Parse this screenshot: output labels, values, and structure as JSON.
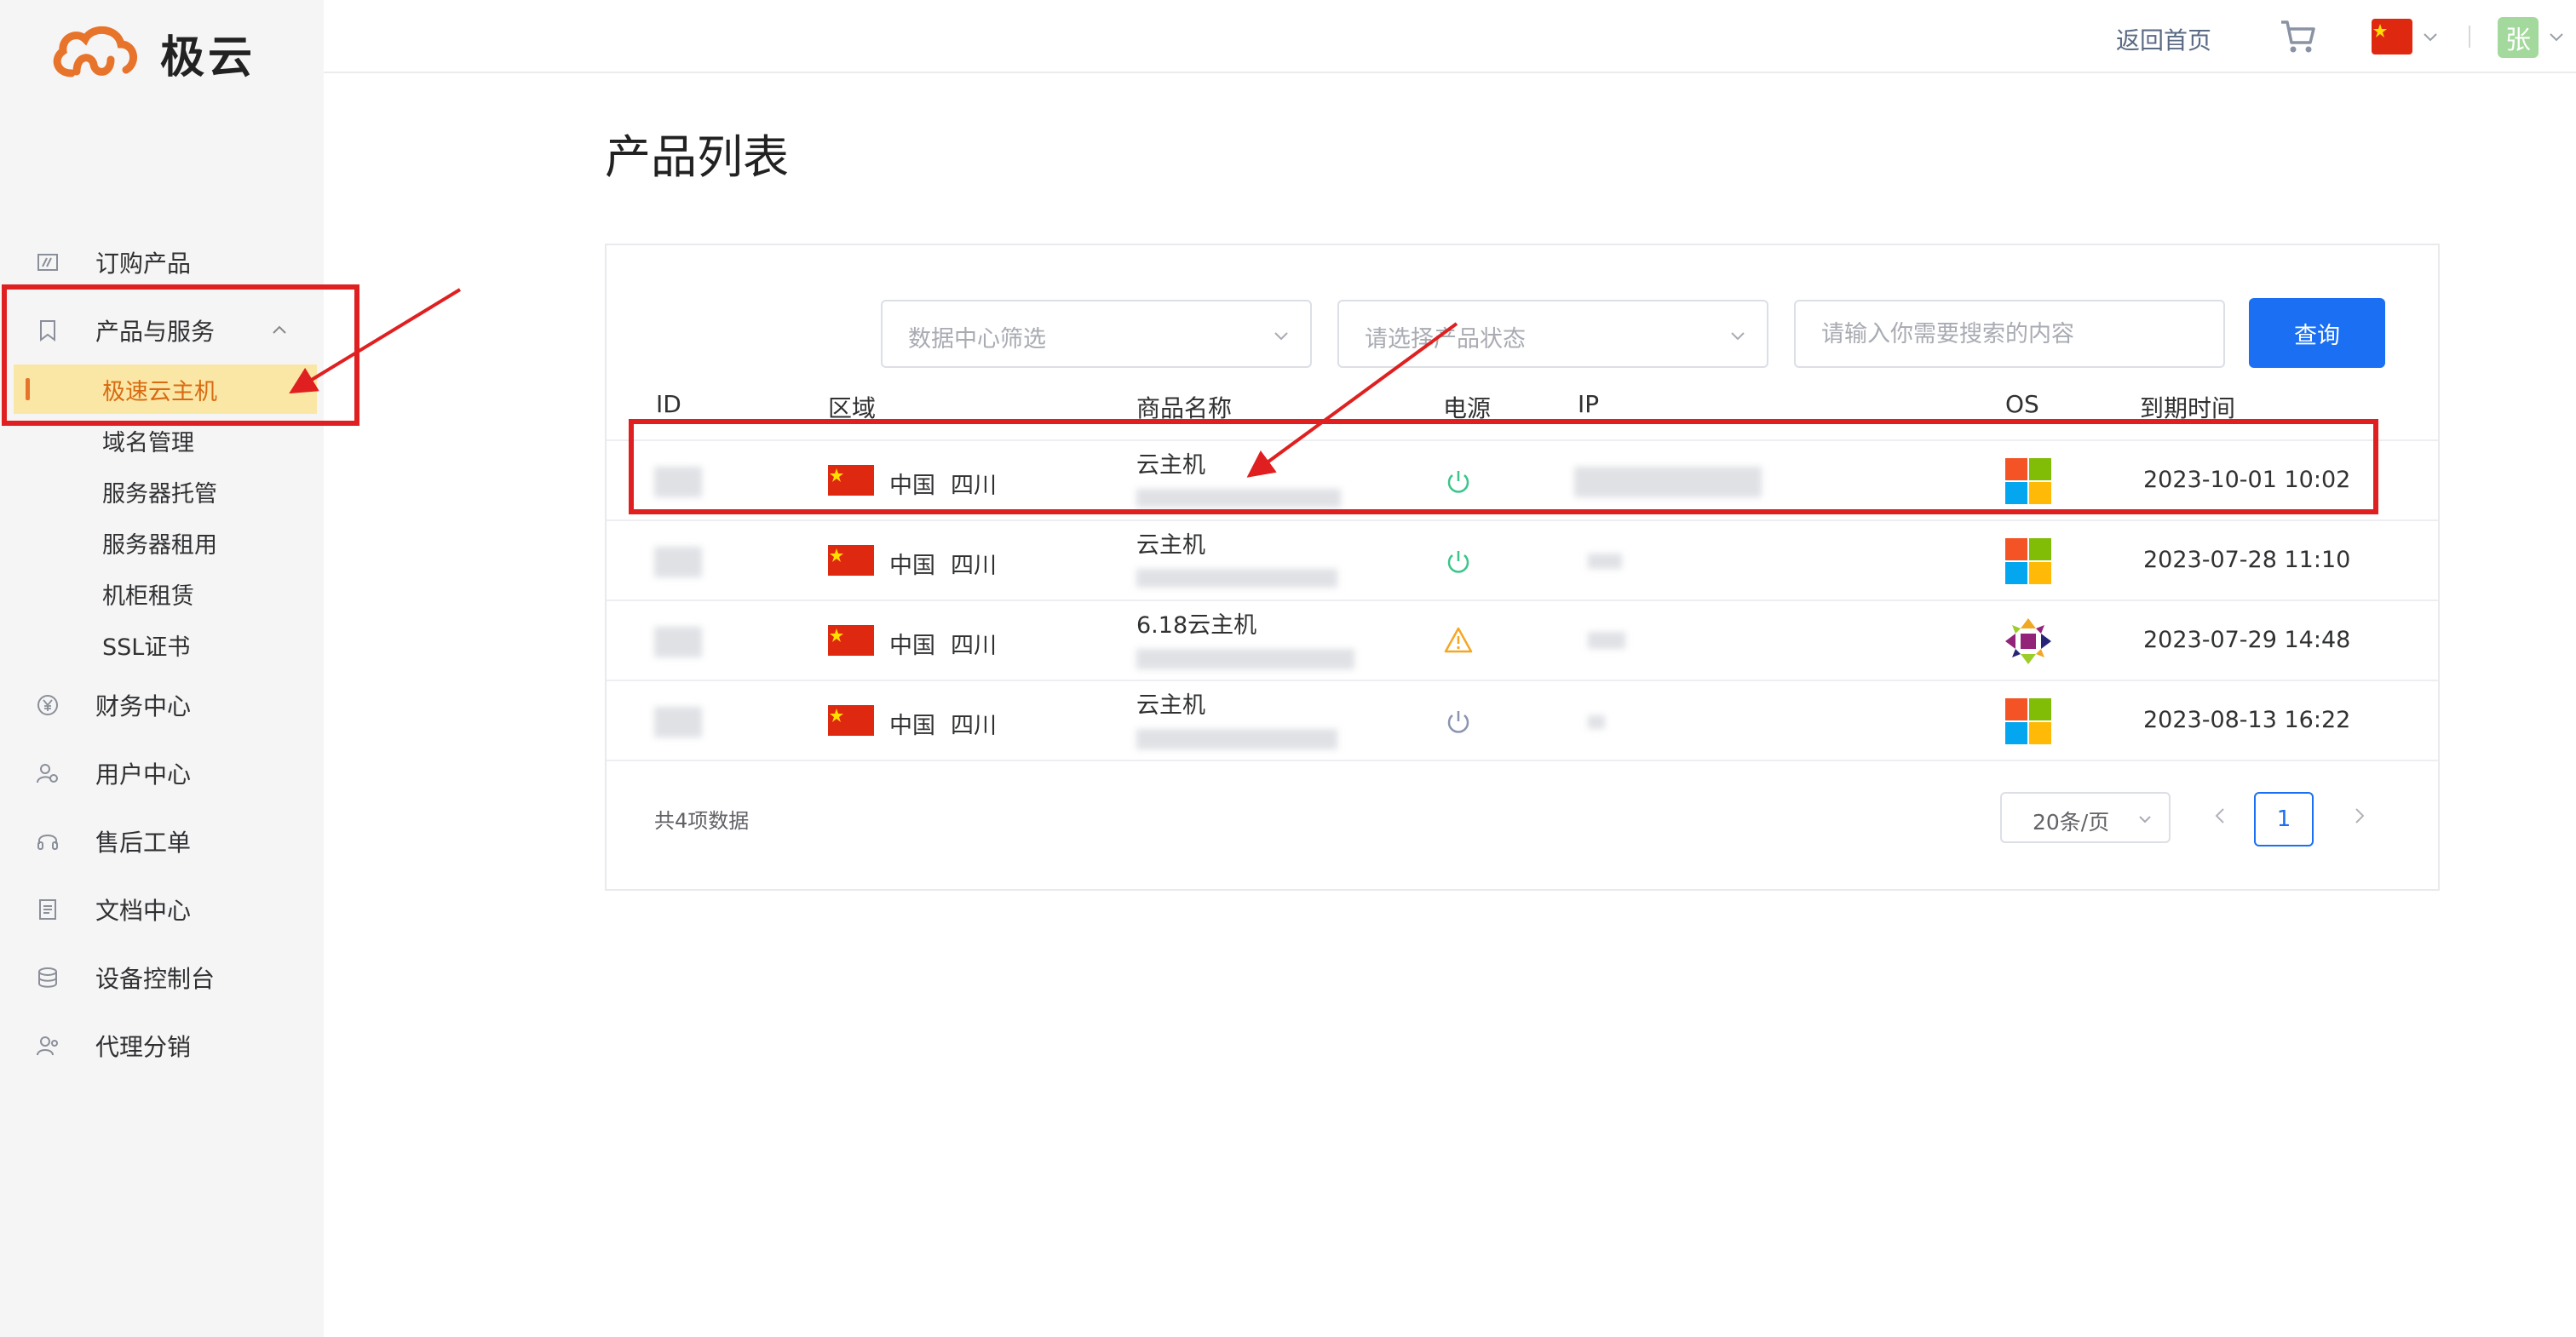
{
  "brand": {
    "name": "极云"
  },
  "sidebar": {
    "items": [
      {
        "label": "订购产品",
        "icon": "order-icon"
      },
      {
        "label": "产品与服务",
        "icon": "bookmark-icon",
        "expanded": true
      },
      {
        "label": "财务中心",
        "icon": "yen-icon"
      },
      {
        "label": "用户中心",
        "icon": "user-settings-icon"
      },
      {
        "label": "售后工单",
        "icon": "headset-icon"
      },
      {
        "label": "文档中心",
        "icon": "document-icon"
      },
      {
        "label": "设备控制台",
        "icon": "database-icon"
      },
      {
        "label": "代理分销",
        "icon": "agent-icon"
      }
    ],
    "subitems": [
      {
        "label": "极速云主机",
        "active": true
      },
      {
        "label": "域名管理"
      },
      {
        "label": "服务器托管"
      },
      {
        "label": "服务器租用"
      },
      {
        "label": "机柜租赁"
      },
      {
        "label": "SSL证书"
      }
    ]
  },
  "topbar": {
    "home_label": "返回首页",
    "avatar_char": "张"
  },
  "page": {
    "title": "产品列表"
  },
  "filters": {
    "datacenter_placeholder": "数据中心筛选",
    "status_placeholder": "请选择产品状态",
    "search_placeholder": "请输入你需要搜索的内容",
    "query_label": "查询"
  },
  "table": {
    "columns": [
      "ID",
      "区域",
      "商品名称",
      "电源",
      "IP",
      "OS",
      "到期时间"
    ],
    "rows": [
      {
        "country": "中国",
        "region": "四川",
        "product": "云主机",
        "power": "on",
        "os": "windows",
        "expires": "2023-10-01 10:02"
      },
      {
        "country": "中国",
        "region": "四川",
        "product": "云主机",
        "power": "on",
        "os": "windows",
        "expires": "2023-07-28 11:10"
      },
      {
        "country": "中国",
        "region": "四川",
        "product": "6.18云主机",
        "power": "warning",
        "os": "centos",
        "expires": "2023-07-29 14:48"
      },
      {
        "country": "中国",
        "region": "四川",
        "product": "云主机",
        "power": "off",
        "os": "windows",
        "expires": "2023-08-13 16:22"
      }
    ]
  },
  "pagination": {
    "total_text": "共4项数据",
    "page_size": "20条/页",
    "current_page": "1"
  },
  "colors": {
    "accent": "#1a6ff2",
    "brand": "#e8732a",
    "annotation": "#e02020",
    "power_on": "#3cc48a",
    "power_warn": "#f5a623",
    "power_off": "#8a93b0"
  }
}
